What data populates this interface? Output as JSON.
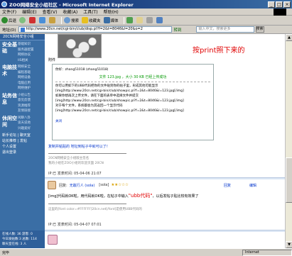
{
  "window": {
    "title": "ZOO网络安全小组社区 - Microsoft Internet Explorer",
    "controls": [
      "_",
      "□",
      "×"
    ]
  },
  "menu": [
    "文件(F)",
    "编辑(E)",
    "查看(V)",
    "收藏(A)",
    "工具(T)",
    "帮助(H)"
  ],
  "toolbar": {
    "back": "后退",
    "forward": "",
    "stop": "",
    "refresh": "",
    "home": "",
    "search": "搜索",
    "favorites": "收藏夹",
    "media": "媒体"
  },
  "address": {
    "label": "地址(D)",
    "url": "http://www.20cn.net/cgi-bin/club/disp.pl?f=2&t=8046&l=20&o=2",
    "go": "转到",
    "search_placeholder": "输入中文，搜索更多",
    "search_button": "搜索"
  },
  "sidebar": {
    "header": "20CN网络安全小组",
    "sections": [
      {
        "title": "安全基础",
        "items": [
          "基础知识",
          "服务器配置",
          "网络协议",
          "IIS相关"
        ]
      },
      {
        "title": "电脑技术",
        "items": [
          "网络安全",
          "编程基础",
          "网络设备",
          "电脑应用",
          "网络维护"
        ]
      },
      {
        "title": "站务信息",
        "items": [
          "小组公告",
          "意见反馈",
          "资源推荐",
          "友情链接"
        ]
      },
      {
        "title": "休闲空间",
        "items": [
          "闲聊八卦",
          "谈天说地",
          "兴趣爱好"
        ]
      }
    ],
    "plain": [
      "新手论坛 | 聊天室",
      "站长推荐 | 发帖",
      "个人设置",
      "退出登录"
    ],
    "stats": [
      "在线人数: 36 游客: 0",
      "今日发帖数:3 总数: 114",
      "聊天室在线: 3 人"
    ]
  },
  "post1": {
    "photo_caption": "附件",
    "red_note": "按print照下来的",
    "upload_lines": [
      "你好：zhang51018 (zhang51018)",
      "文件 123.jpg ，大小 30 KB 已经上传成功",
      "你可以用如下的UBB代码把你的文件贴到你的帖子里，形成其他可能显示",
      "[img]http://www.20cn.net/cgi-bin/club/showpic.pl?f=2&t=8046&l=123.jpg[/img]",
      "如果你想再次上传文件，请在下面的表单中选择文件并提交",
      "[img]http://www.20cn.net/cgi-bin/club/showpic.pl?f=2&t=8046&l=123.jpg[/img]",
      "对于每个文件，系统都会为其返回一个显示代码",
      "[img]http://www.20cn.net/cgi-bin/club/showpic.pl?f=2&t=8046&l=123.jpg[/img]"
    ],
    "close_link": "关闭",
    "reply_text": "复制并粘贴的 地址到帖子中就可以了！",
    "signature": [
      "20CN网络安全小组版主签名",
      "我的小组在ZOO小组的欢迎页面 20CN"
    ],
    "meta": "IP:已 发表时间: 05-04-06 21:07"
  },
  "post2": {
    "mark": "回复:",
    "name": "无敌行人 (sola)",
    "status": "[sola]",
    "stars": "★★☆☆☆",
    "actions": [
      "回复",
      "编辑"
    ],
    "reply_pre": "[img]代码就OK啦，用代码就OK啦，在帖子中输入",
    "reply_red": "\"ubb代码\"",
    "reply_post": "，以后发帖子贴比较有效果了",
    "signature": "这里的[font color=#FFFFFF]20cn.net[/font]是使用UBB代码的",
    "meta": "IP:已 发表时间: 05-04-07 07:01"
  },
  "statusbar": {
    "text": "完毕",
    "zone": "Internet"
  }
}
